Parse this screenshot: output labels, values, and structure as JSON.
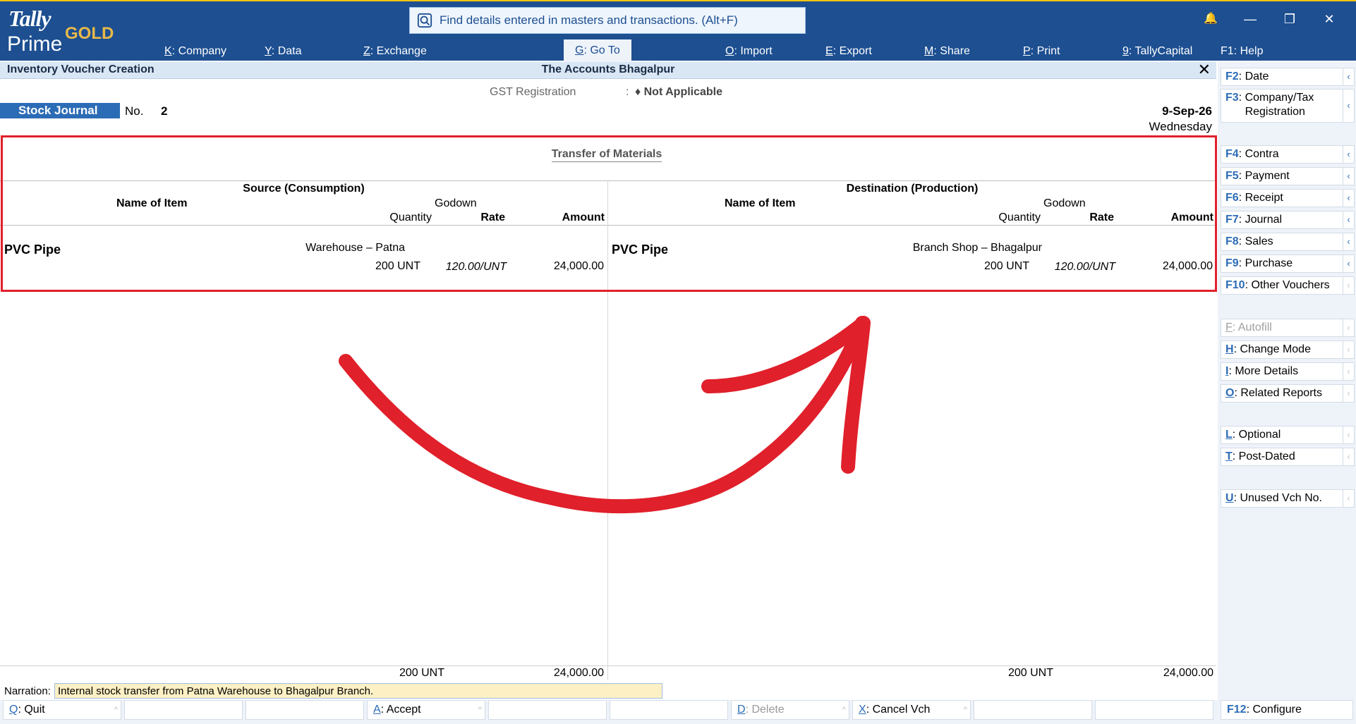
{
  "brand": {
    "tally": "Tally",
    "prime": "Prime",
    "edition": "GOLD"
  },
  "search": {
    "text": "Find details entered in masters and transactions. (Alt+F)"
  },
  "window_controls": {
    "notify": "🔔",
    "minimize": "—",
    "restore": "❐",
    "close": "✕"
  },
  "menu": [
    {
      "key": "K",
      "label": "Company"
    },
    {
      "key": "Y",
      "label": "Data"
    },
    {
      "key": "Z",
      "label": "Exchange"
    },
    {
      "key": "G",
      "label": "Go To"
    },
    {
      "key": "O",
      "label": "Import"
    },
    {
      "key": "E",
      "label": "Export"
    },
    {
      "key": "M",
      "label": "Share"
    },
    {
      "key": "P",
      "label": "Print"
    },
    {
      "key": "9",
      "label": "TallyCapital"
    },
    {
      "key": "F1",
      "label": "Help"
    }
  ],
  "screen": {
    "title": "Inventory Voucher Creation",
    "company": "The Accounts Bhagalpur",
    "close": "✕"
  },
  "gst": {
    "label": "GST Registration",
    "sep": ":",
    "value": "♦ Not Applicable"
  },
  "voucher": {
    "type": "Stock Journal",
    "no_label": "No.",
    "no": "2",
    "date": "9-Sep-26",
    "day": "Wednesday"
  },
  "section_title": "Transfer of Materials",
  "source": {
    "heading": "Source (Consumption)",
    "col_item": "Name of Item",
    "col_godown": "Godown",
    "col_qty": "Quantity",
    "col_rate": "Rate",
    "col_amount": "Amount",
    "item": "PVC Pipe",
    "godown": "Warehouse – Patna",
    "qty": "200 UNT",
    "rate": "120.00/UNT",
    "amount": "24,000.00",
    "total_qty": "200 UNT",
    "total_amount": "24,000.00"
  },
  "destination": {
    "heading": "Destination (Production)",
    "col_item": "Name of Item",
    "col_godown": "Godown",
    "col_qty": "Quantity",
    "col_rate": "Rate",
    "col_amount": "Amount",
    "item": "PVC Pipe",
    "godown": "Branch Shop – Bhagalpur",
    "qty": "200 UNT",
    "rate": "120.00/UNT",
    "amount": "24,000.00",
    "total_qty": "200 UNT",
    "total_amount": "24,000.00"
  },
  "narration": {
    "label": "Narration:",
    "value": "Internal stock transfer from Patna Warehouse to Bhagalpur Branch."
  },
  "bottom_buttons": {
    "quit": {
      "key": "Q",
      "label": "Quit"
    },
    "accept": {
      "key": "A",
      "label": "Accept"
    },
    "delete": {
      "key": "D",
      "label": "Delete"
    },
    "cancel": {
      "key": "X",
      "label": "Cancel Vch"
    },
    "configure": {
      "key": "F12",
      "label": "Configure"
    },
    "caret": "^"
  },
  "right_panel": {
    "arrow": "‹",
    "date": {
      "key": "F2",
      "label": "Date"
    },
    "company_tax": {
      "key": "F3",
      "label": "Company/Tax Registration"
    },
    "contra": {
      "key": "F4",
      "label": "Contra"
    },
    "payment": {
      "key": "F5",
      "label": "Payment"
    },
    "receipt": {
      "key": "F6",
      "label": "Receipt"
    },
    "journal": {
      "key": "F7",
      "label": "Journal"
    },
    "sales": {
      "key": "F8",
      "label": "Sales"
    },
    "purchase": {
      "key": "F9",
      "label": "Purchase"
    },
    "other_vouchers": {
      "key": "F10",
      "label": "Other Vouchers"
    },
    "autofill": {
      "key": "F",
      "label": "Autofill"
    },
    "change_mode": {
      "key": "H",
      "label": "Change Mode"
    },
    "more_details": {
      "key": "I",
      "label": "More Details"
    },
    "related_reports": {
      "key": "O",
      "label": "Related Reports"
    },
    "optional": {
      "key": "L",
      "label": "Optional"
    },
    "post_dated": {
      "key": "T",
      "label": "Post-Dated"
    },
    "unused_vch": {
      "key": "U",
      "label": "Unused Vch No."
    }
  },
  "colors": {
    "header": "#1d4f91",
    "accent": "#2c6cb6",
    "highlight": "#e0202b",
    "narration_bg": "#fdf0c4"
  }
}
